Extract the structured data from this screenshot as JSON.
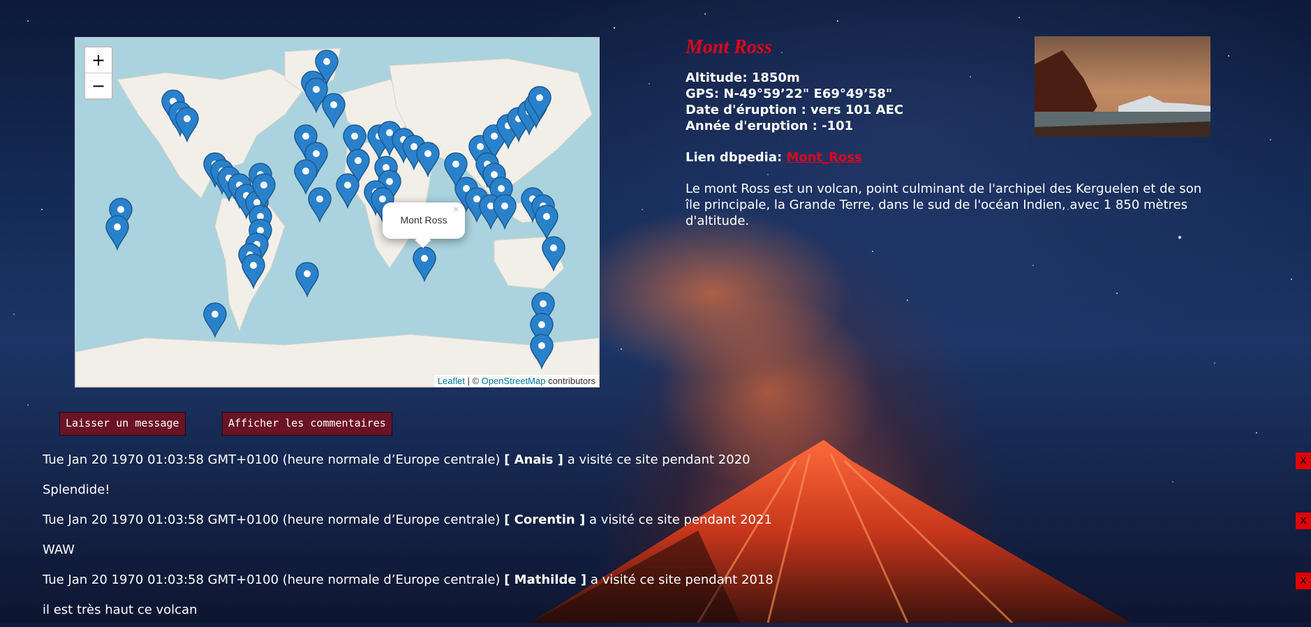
{
  "map": {
    "zoom_in": "+",
    "zoom_out": "−",
    "popup_text": "Mont Ross",
    "popup_close": "×",
    "attribution_leaflet": "Leaflet",
    "attribution_sep": " | © ",
    "attribution_osm": "OpenStreetMap",
    "attribution_tail": " contributors"
  },
  "volcano": {
    "name": "Mont Ross",
    "altitude": "Altitude: 1850m",
    "gps": "GPS: N-49°59’22\"   E69°49’58\"",
    "eruption_date": "Date d'éruption : vers 101 AEC",
    "eruption_year": "Année d'eruption : -101",
    "dbpedia_label": "Lien dbpedia: ",
    "dbpedia_link": "Mont_Ross",
    "description": "Le mont Ross est un volcan, point culminant de l'archipel des Kerguelen et de son île principale, la Grande Terre, dans le sud de l'océan Indien, avec 1 850 mètres d'altitude."
  },
  "buttons": {
    "leave_message": "Laisser un message",
    "show_comments": "Afficher les commentaires"
  },
  "comments": [
    {
      "date": "Tue Jan 20 1970 01:03:58 GMT+0100 (heure normale d’Europe centrale)",
      "user": "[ Anais ]",
      "visited": "a visité ce site pendant 2020",
      "text": "Splendide!",
      "delete": "x"
    },
    {
      "date": "Tue Jan 20 1970 01:03:58 GMT+0100 (heure normale d’Europe centrale)",
      "user": "[ Corentin ]",
      "visited": "a visité ce site pendant 2021",
      "text": "WAW",
      "delete": "x"
    },
    {
      "date": "Tue Jan 20 1970 01:03:58 GMT+0100 (heure normale d’Europe centrale)",
      "user": "[ Mathilde ]",
      "visited": "a visité ce site pendant 2018",
      "text": "il est très haut ce volcan",
      "delete": "x"
    }
  ],
  "colors": {
    "accent_red": "#e0001a",
    "button_bg": "#6b1326",
    "marker_blue": "#2a81cb",
    "water": "#aad3df",
    "land": "#f2efe9"
  }
}
